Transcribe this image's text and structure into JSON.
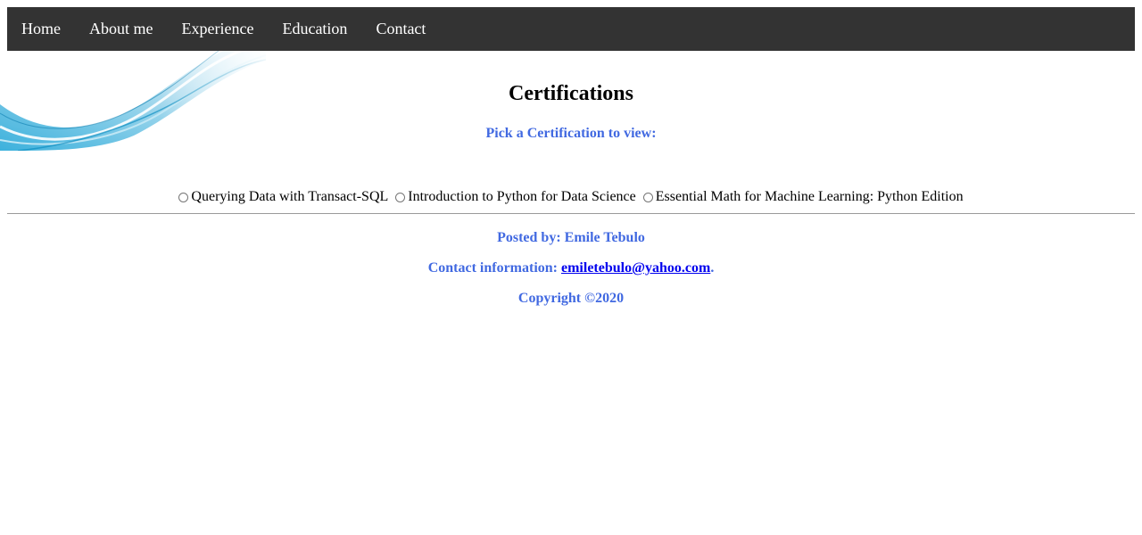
{
  "nav": {
    "items": [
      {
        "label": "Home"
      },
      {
        "label": "About me"
      },
      {
        "label": "Experience"
      },
      {
        "label": "Education"
      },
      {
        "label": "Contact"
      }
    ]
  },
  "main": {
    "title": "Certifications",
    "subtitle": "Pick a Certification to view:",
    "certifications": [
      {
        "label": "Querying Data with Transact-SQL"
      },
      {
        "label": "Introduction to Python for Data Science"
      },
      {
        "label": "Essential Math for Machine Learning: Python Edition"
      }
    ]
  },
  "footer": {
    "posted_by": "Posted by: Emile Tebulo",
    "contact_label": "Contact information: ",
    "contact_email": "emiletebulo@yahoo.com",
    "contact_suffix": ".",
    "copyright": "Copyright ©2020"
  },
  "colors": {
    "nav_bg": "#333333",
    "accent": "#4169e1",
    "link": "#0000ee"
  }
}
